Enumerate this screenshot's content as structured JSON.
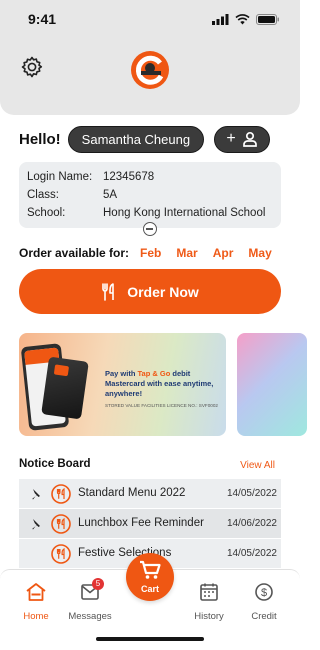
{
  "status_bar": {
    "time": "9:41"
  },
  "header": {
    "settings_icon": "gear-icon",
    "logo_icon": "app-logo"
  },
  "greeting": {
    "hello": "Hello!",
    "student_name": "Samantha Cheung",
    "add_icon": "add-person-icon"
  },
  "student_info": {
    "login_label": "Login Name:",
    "login_value": "12345678",
    "class_label": "Class:",
    "class_value": "5A",
    "school_label": "School:",
    "school_value": "Hong Kong International School"
  },
  "order": {
    "available_label": "Order available for:",
    "months": [
      "Feb",
      "Mar",
      "Apr",
      "May"
    ],
    "button_label": "Order Now",
    "button_icon": "utensils-icon"
  },
  "banner": {
    "line_prefix": "Pay with ",
    "line_brand": "Tap & Go",
    "line_rest": " debit Mastercard with ease anytime, anywhere!",
    "fine_print": "STORED VALUE FACILITIES LICENCE NO.: SVF0002",
    "card_brand": "Tap & Go"
  },
  "notices": {
    "title": "Notice Board",
    "view_all": "View All",
    "items": [
      {
        "title": "Standard Menu 2022",
        "date": "14/05/2022",
        "pinned": true
      },
      {
        "title": "Lunchbox Fee Reminder",
        "date": "14/06/2022",
        "pinned": true
      },
      {
        "title": "Festive Selections",
        "date": "14/05/2022",
        "pinned": false
      }
    ]
  },
  "tabs": {
    "home": "Home",
    "messages": "Messages",
    "messages_badge": "5",
    "cart": "Cart",
    "history": "History",
    "credit": "Credit"
  },
  "colors": {
    "accent": "#ef5713",
    "dark_pill": "#3b3b3b",
    "header_bg": "#e7e7e7"
  }
}
